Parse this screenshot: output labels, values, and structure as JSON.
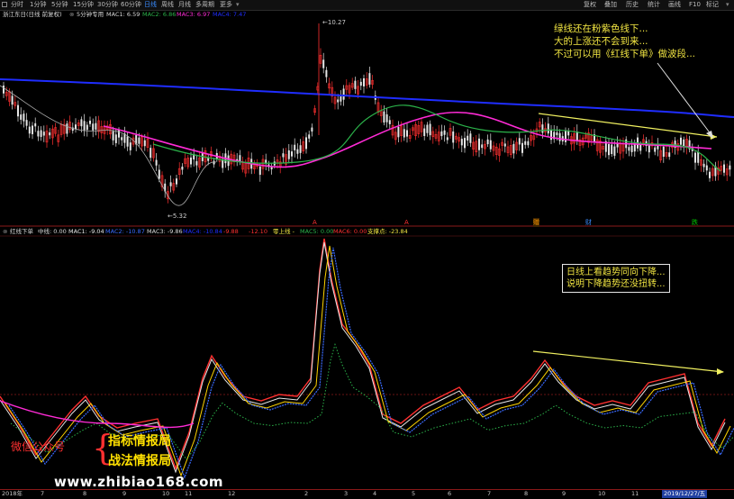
{
  "toolbar": {
    "timeframes": [
      {
        "label": "分时",
        "active": false
      },
      {
        "label": "1分钟",
        "active": false
      },
      {
        "label": "5分钟",
        "active": false
      },
      {
        "label": "15分钟",
        "active": false
      },
      {
        "label": "30分钟",
        "active": false
      },
      {
        "label": "60分钟",
        "active": false
      },
      {
        "label": "日线",
        "active": true
      },
      {
        "label": "周线",
        "active": false
      },
      {
        "label": "月线",
        "active": false
      },
      {
        "label": "多周期",
        "active": false
      },
      {
        "label": "更多",
        "active": false
      }
    ],
    "right_items": [
      "复权",
      "叠加",
      "历史",
      "统计",
      "画线",
      "F10",
      "标记"
    ]
  },
  "main_indicator": {
    "stock_name": "浙江东日(日线 前复权)",
    "indicator_name": "5分钟专用",
    "mac1": "MAC1: 6.59",
    "mac2": "MAC2: 6.86",
    "mac3": "MAC3: 6.97",
    "mac4": "MAC4: 7.47"
  },
  "price_labels": {
    "high": "10.27",
    "low": "5.32"
  },
  "annotation_top": [
    "绿线还在粉紫色线下...",
    "大的上涨还不会到来...",
    "不过可以用《红线下单》做波段..."
  ],
  "event_markers": [
    {
      "label": "A",
      "color": "#ff3030"
    },
    {
      "label": "A",
      "color": "#ff3030"
    },
    {
      "label": "赠",
      "color": "#ff9900"
    },
    {
      "label": "财",
      "color": "#3a8cff"
    },
    {
      "label": "跌",
      "color": "#00c800"
    }
  ],
  "sub_indicator": {
    "name": "红线下单",
    "zhongxian": "中线: 0.00",
    "mac1": "MAC1: -9.04",
    "mac2": "MAC2: -10.87",
    "mac3": "MAC3: -9.86",
    "mac4": "MAC4: -10.84",
    "mac5_a": "-9.88",
    "mac6_a": "-12.10",
    "lingshang": "零上线 -",
    "mac5": "MAC5: 0.00",
    "mac6": "MAC6: 0.00",
    "zhicheng": "支撑点: -23.84"
  },
  "annotation_box": [
    "日线上看趋势同向下降...",
    "说明下降趋势还没扭转..."
  ],
  "watermark": {
    "wechat": "微信公众号",
    "line1": "指标情报局",
    "line2": "战法情报局",
    "url": "www.zhibiao168.com"
  },
  "x_axis": {
    "labels": [
      "2018年",
      "7",
      "8",
      "9",
      "10",
      "11",
      "12",
      "2",
      "3",
      "4",
      "5",
      "6",
      "7",
      "8",
      "9",
      "10",
      "11",
      "12"
    ],
    "highlight": "2019/12/27/五"
  },
  "colors": {
    "ma_blue": "#1f2dff",
    "ma_magenta": "#ff2bd6",
    "ma_green": "#2bb34a",
    "candle_up": "#ff3030",
    "candle_down": "#e6e6e6",
    "trend_yellow": "#f0f060",
    "sub_red": "#ff3030",
    "sub_white": "#e6e6e6",
    "sub_yellow": "#ffd400",
    "sub_blue": "#3a6bff",
    "sub_magenta": "#ff2bd6",
    "sub_green_dotted": "#2bb34a"
  }
}
